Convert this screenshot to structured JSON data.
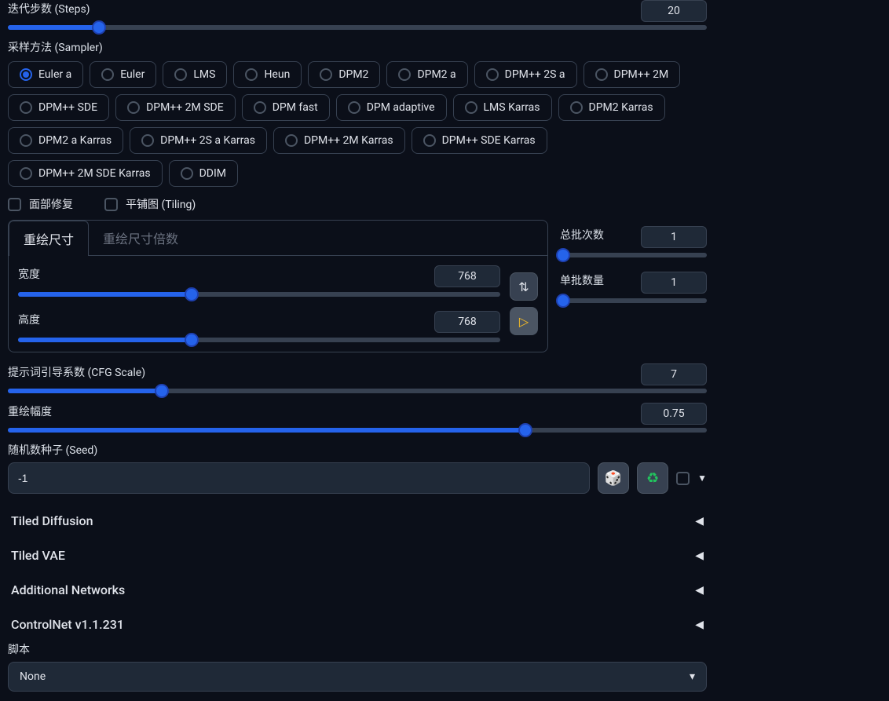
{
  "steps": {
    "label": "迭代步数 (Steps)",
    "value": "20",
    "pct": 13
  },
  "sampler": {
    "label": "采样方法 (Sampler)",
    "selected": 0,
    "options": [
      "Euler a",
      "Euler",
      "LMS",
      "Heun",
      "DPM2",
      "DPM2 a",
      "DPM++ 2S a",
      "DPM++ 2M",
      "DPM++ SDE",
      "DPM++ 2M SDE",
      "DPM fast",
      "DPM adaptive",
      "LMS Karras",
      "DPM2 Karras",
      "DPM2 a Karras",
      "DPM++ 2S a Karras",
      "DPM++ 2M Karras",
      "DPM++ SDE Karras",
      "DPM++ 2M SDE Karras",
      "DDIM"
    ]
  },
  "checks": {
    "face_restore": "面部修复",
    "tiling": "平铺图 (Tiling)"
  },
  "resize_tabs": {
    "active": "重绘尺寸",
    "inactive": "重绘尺寸倍数"
  },
  "width": {
    "label": "宽度",
    "value": "768",
    "pct": 36
  },
  "height": {
    "label": "高度",
    "value": "768",
    "pct": 36
  },
  "swap_icon": "⇅",
  "cursor_icon": "↖",
  "batch_count": {
    "label": "总批次数",
    "value": "1",
    "pct": 0
  },
  "batch_size": {
    "label": "单批数量",
    "value": "1",
    "pct": 0
  },
  "cfg": {
    "label": "提示词引导系数 (CFG Scale)",
    "value": "7",
    "pct": 22
  },
  "denoise": {
    "label": "重绘幅度",
    "value": "0.75",
    "pct": 74
  },
  "seed": {
    "label": "随机数种子 (Seed)",
    "value": "-1",
    "dice": "🎲",
    "recycle": "♻",
    "caret": "▼"
  },
  "accordions": [
    "Tiled Diffusion",
    "Tiled VAE",
    "Additional Networks",
    "ControlNet v1.1.231"
  ],
  "accordion_arrow": "◀",
  "script": {
    "label": "脚本",
    "value": "None",
    "caret": "▾"
  }
}
